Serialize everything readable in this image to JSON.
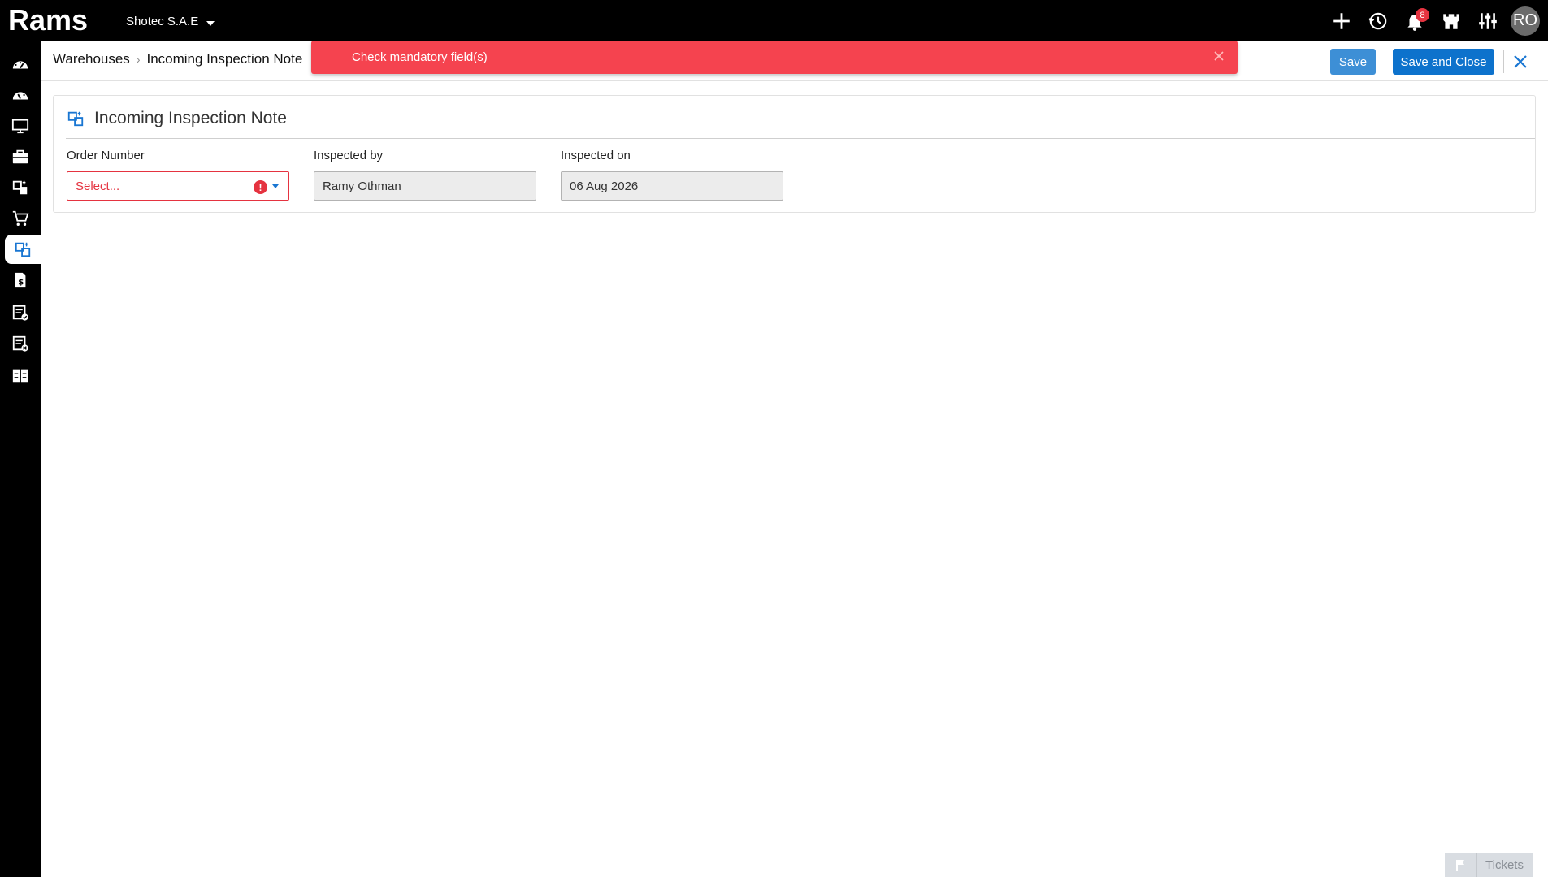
{
  "app": {
    "logo_text": "Rams"
  },
  "topbar": {
    "company": "Shotec S.A.E",
    "notifications_count": "8",
    "user_initials": "RO",
    "icons": [
      "plus-icon",
      "history-icon",
      "bell-icon",
      "castle-icon",
      "sliders-icon"
    ]
  },
  "sidebar": {
    "items": [
      {
        "name": "dashboard-icon"
      },
      {
        "name": "dashboard-2-icon"
      },
      {
        "name": "monitor-icon"
      },
      {
        "name": "briefcase-icon"
      },
      {
        "name": "warehouse-icon",
        "active": false
      },
      {
        "name": "shopping-cart-icon"
      },
      {
        "name": "inspection-icon",
        "active": true
      },
      {
        "name": "invoice-icon"
      },
      {
        "name": "approved-doc-icon"
      },
      {
        "name": "rejected-doc-icon"
      },
      {
        "name": "layout-icon"
      }
    ]
  },
  "breadcrumb": {
    "parent": "Warehouses",
    "separator": ">",
    "current": "Incoming Inspection Note"
  },
  "toolbar": {
    "save_label": "Save",
    "save_close_label": "Save and Close"
  },
  "toast": {
    "message": "Check mandatory field(s)",
    "color": "#f5434f"
  },
  "form": {
    "title": "Incoming Inspection Note",
    "fields": {
      "order_number": {
        "label": "Order Number",
        "placeholder": "Select...",
        "error_mark": "!"
      },
      "inspected_by": {
        "label": "Inspected by",
        "value": "Ramy  Othman"
      },
      "inspected_on": {
        "label": "Inspected on",
        "value": "06 Aug 2026"
      }
    }
  },
  "tickets": {
    "label": "Tickets"
  },
  "colors": {
    "primary": "#0d72cc",
    "error": "#e53340"
  }
}
